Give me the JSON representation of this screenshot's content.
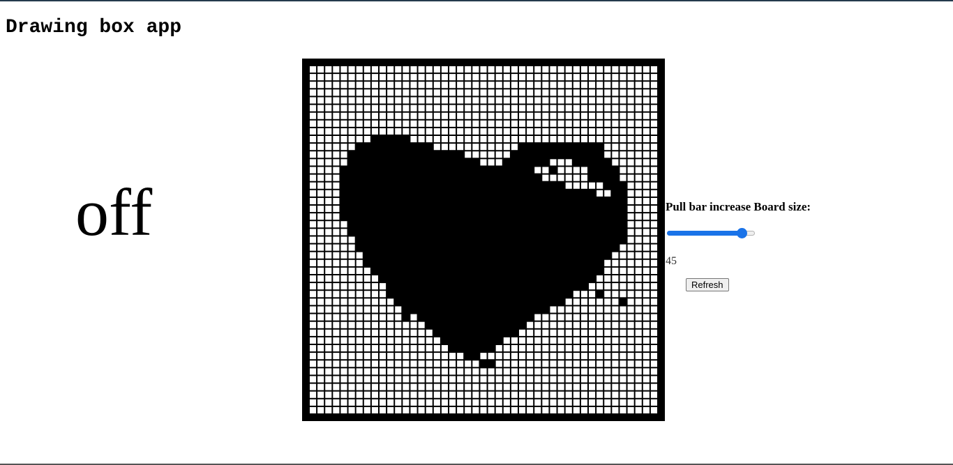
{
  "app": {
    "title": "Drawing box app",
    "status": "off"
  },
  "board": {
    "size": 45,
    "cell_color": "#ffffff",
    "line_color": "#000000",
    "fill_color": "#000000",
    "filled_rows": [
      {
        "r": 9,
        "spans": [
          [
            8,
            12
          ]
        ]
      },
      {
        "r": 10,
        "spans": [
          [
            6,
            15
          ],
          [
            27,
            37
          ]
        ]
      },
      {
        "r": 11,
        "spans": [
          [
            5,
            19
          ],
          [
            26,
            37
          ]
        ]
      },
      {
        "r": 12,
        "spans": [
          [
            5,
            21
          ],
          [
            25,
            30
          ],
          [
            34,
            38
          ]
        ]
      },
      {
        "r": 13,
        "spans": [
          [
            4,
            28
          ],
          [
            31,
            31
          ],
          [
            36,
            39
          ]
        ]
      },
      {
        "r": 14,
        "spans": [
          [
            4,
            29
          ],
          [
            36,
            39
          ]
        ]
      },
      {
        "r": 15,
        "spans": [
          [
            4,
            32
          ],
          [
            38,
            40
          ]
        ]
      },
      {
        "r": 16,
        "spans": [
          [
            4,
            36
          ],
          [
            39,
            40
          ]
        ]
      },
      {
        "r": 17,
        "spans": [
          [
            4,
            40
          ]
        ]
      },
      {
        "r": 18,
        "spans": [
          [
            4,
            40
          ]
        ]
      },
      {
        "r": 19,
        "spans": [
          [
            4,
            40
          ]
        ]
      },
      {
        "r": 20,
        "spans": [
          [
            5,
            40
          ]
        ]
      },
      {
        "r": 21,
        "spans": [
          [
            5,
            40
          ]
        ]
      },
      {
        "r": 22,
        "spans": [
          [
            6,
            40
          ]
        ]
      },
      {
        "r": 23,
        "spans": [
          [
            6,
            39
          ]
        ]
      },
      {
        "r": 24,
        "spans": [
          [
            7,
            38
          ]
        ]
      },
      {
        "r": 25,
        "spans": [
          [
            7,
            37
          ]
        ]
      },
      {
        "r": 26,
        "spans": [
          [
            8,
            37
          ]
        ]
      },
      {
        "r": 27,
        "spans": [
          [
            9,
            36
          ]
        ]
      },
      {
        "r": 28,
        "spans": [
          [
            10,
            35
          ]
        ]
      },
      {
        "r": 29,
        "spans": [
          [
            10,
            33
          ],
          [
            37,
            37
          ]
        ]
      },
      {
        "r": 30,
        "spans": [
          [
            11,
            32
          ],
          [
            40,
            40
          ]
        ]
      },
      {
        "r": 31,
        "spans": [
          [
            12,
            30
          ]
        ]
      },
      {
        "r": 32,
        "spans": [
          [
            12,
            12
          ],
          [
            14,
            28
          ]
        ]
      },
      {
        "r": 33,
        "spans": [
          [
            15,
            27
          ]
        ]
      },
      {
        "r": 34,
        "spans": [
          [
            16,
            26
          ]
        ]
      },
      {
        "r": 35,
        "spans": [
          [
            17,
            24
          ]
        ]
      },
      {
        "r": 36,
        "spans": [
          [
            18,
            23
          ]
        ]
      },
      {
        "r": 37,
        "spans": [
          [
            20,
            21
          ]
        ]
      },
      {
        "r": 38,
        "spans": [
          [
            22,
            23
          ]
        ]
      }
    ]
  },
  "controls": {
    "label": "Pull bar increase Board size:",
    "slider": {
      "min": 0,
      "max": 50,
      "value": 45,
      "accent": "#1a73e8"
    },
    "value_text": "45",
    "refresh_label": "Refresh"
  }
}
